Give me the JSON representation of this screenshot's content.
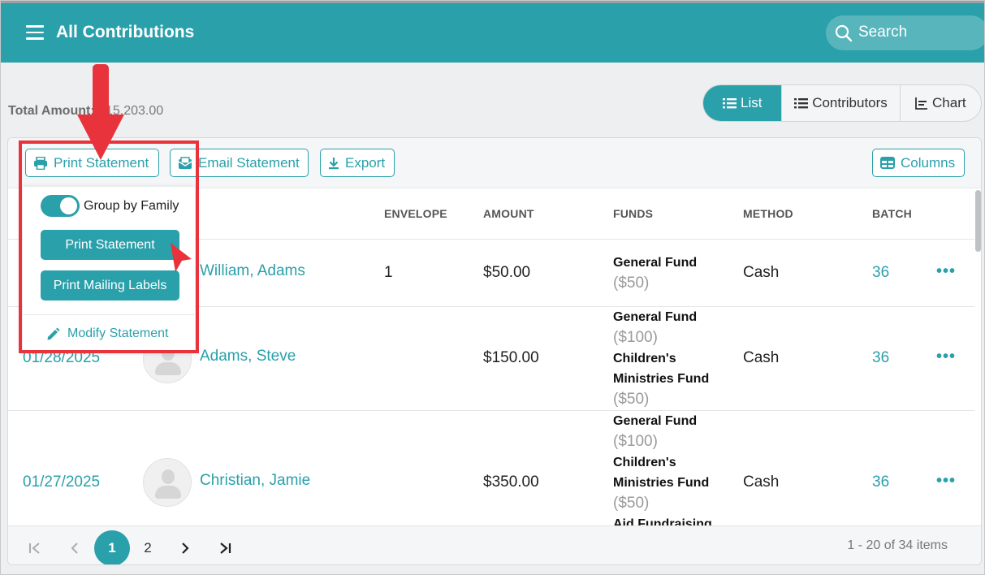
{
  "header": {
    "title": "All Contributions",
    "search_placeholder": "Search"
  },
  "summary": {
    "total_label": "Total Amount:",
    "total_value": "$15,203.00"
  },
  "view_tabs": [
    {
      "label": "List",
      "icon": "list-icon",
      "active": true
    },
    {
      "label": "Contributors",
      "icon": "list-icon",
      "active": false
    },
    {
      "label": "Chart",
      "icon": "chart-icon",
      "active": false
    }
  ],
  "toolbar": {
    "print_statement": "Print Statement",
    "email_statement": "Email Statement",
    "export": "Export",
    "columns": "Columns"
  },
  "print_menu": {
    "group_by_family": "Group by Family",
    "group_by_family_on": true,
    "print_statement": "Print Statement",
    "print_mailing_labels": "Print Mailing Labels",
    "modify_statement": "Modify Statement"
  },
  "table": {
    "columns": [
      "ENVELOPE",
      "AMOUNT",
      "FUNDS",
      "METHOD",
      "BATCH"
    ],
    "rows": [
      {
        "date": "",
        "name": "William, Adams",
        "envelope": "1",
        "amount": "$50.00",
        "funds": [
          {
            "name": "General Fund",
            "amount": "($50)"
          }
        ],
        "method": "Cash",
        "batch": "36"
      },
      {
        "date": "01/28/2025",
        "name": "Adams, Steve",
        "envelope": "",
        "amount": "$150.00",
        "funds": [
          {
            "name": "General Fund",
            "amount": "($100)"
          },
          {
            "name": "Children's Ministries Fund",
            "amount": "($50)"
          }
        ],
        "method": "Cash",
        "batch": "36"
      },
      {
        "date": "01/27/2025",
        "name": "Christian, Jamie",
        "envelope": "",
        "amount": "$350.00",
        "funds": [
          {
            "name": "General Fund",
            "amount": "($100)"
          },
          {
            "name": "Children's Ministries Fund",
            "amount": "($50)"
          },
          {
            "name": "Aid Fundraising",
            "amount": ""
          }
        ],
        "method": "Cash",
        "batch": "36"
      }
    ]
  },
  "pagination": {
    "current_page": "1",
    "pages": [
      "1",
      "2"
    ],
    "items_text": "1 - 20 of 34 items"
  },
  "colors": {
    "accent": "#2aa0aa",
    "annotation": "#e8333c"
  }
}
